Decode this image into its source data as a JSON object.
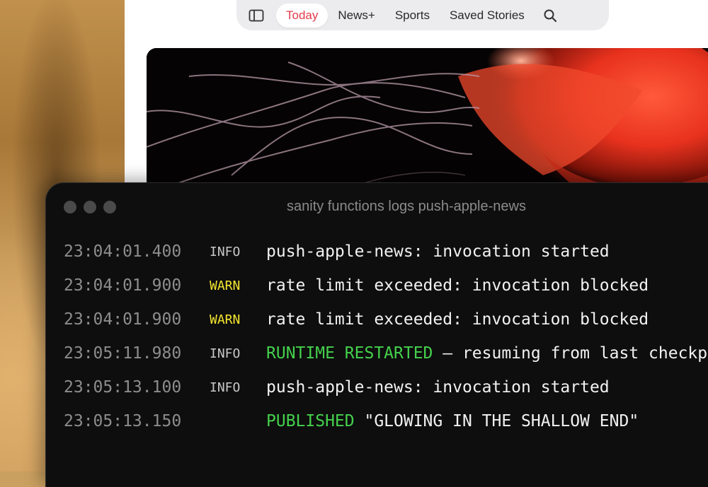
{
  "nav": {
    "sidebar_icon": "sidebar-toggle-icon",
    "tabs": [
      {
        "label": "Today",
        "active": true
      },
      {
        "label": "News+",
        "active": false
      },
      {
        "label": "Sports",
        "active": false
      },
      {
        "label": "Saved Stories",
        "active": false
      }
    ],
    "search_icon": "search-icon"
  },
  "colors": {
    "active_tab": "#e23a4a",
    "warn": "#f3e531",
    "highlight": "#44d14c",
    "terminal_bg": "#0e0e0e"
  },
  "terminal": {
    "title": "sanity functions logs push-apple-news",
    "rows": [
      {
        "time": "23:04:01.400",
        "level": "INFO",
        "highlight": "",
        "message": "push-apple-news: invocation started"
      },
      {
        "time": "23:04:01.900",
        "level": "WARN",
        "highlight": "",
        "message": "rate limit exceeded: invocation blocked"
      },
      {
        "time": "23:04:01.900",
        "level": "WARN",
        "highlight": "",
        "message": "rate limit exceeded: invocation blocked"
      },
      {
        "time": "23:05:11.980",
        "level": "INFO",
        "highlight": "RUNTIME RESTARTED",
        "message": " — resuming from last checkpoint"
      },
      {
        "time": "23:05:13.100",
        "level": "INFO",
        "highlight": "",
        "message": "push-apple-news: invocation started"
      },
      {
        "time": "23:05:13.150",
        "level": "",
        "highlight": "PUBLISHED",
        "message": " \"GLOWING IN THE SHALLOW END\""
      }
    ]
  }
}
